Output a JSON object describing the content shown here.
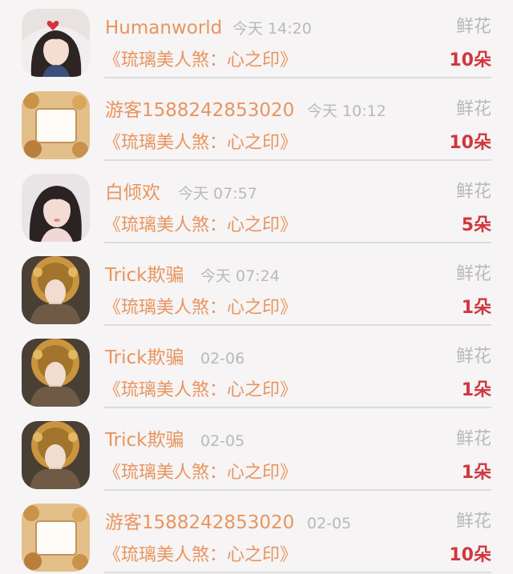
{
  "records": [
    {
      "user": "Humanworld",
      "time": "今天 14:20",
      "gift": "鲜花",
      "title": "《琉璃美人煞：心之印》",
      "count": "10朵",
      "avatar_icon": "girl-heart-avatar"
    },
    {
      "user": "游客1588242853020",
      "time": "今天 10:12",
      "gift": "鲜花",
      "title": "《琉璃美人煞：心之印》",
      "count": "10朵",
      "avatar_icon": "floral-frame-avatar"
    },
    {
      "user": "白倾欢",
      "time": "今天 07:57",
      "gift": "鲜花",
      "title": "《琉璃美人煞：心之印》",
      "count": "5朵",
      "avatar_icon": "woman-portrait-avatar"
    },
    {
      "user": "Trick欺骗",
      "time": "今天 07:24",
      "gift": "鲜花",
      "title": "《琉璃美人煞：心之印》",
      "count": "1朵",
      "avatar_icon": "ornate-headdress-avatar"
    },
    {
      "user": "Trick欺骗",
      "time": "02-06",
      "gift": "鲜花",
      "title": "《琉璃美人煞：心之印》",
      "count": "1朵",
      "avatar_icon": "ornate-headdress-avatar"
    },
    {
      "user": "Trick欺骗",
      "time": "02-05",
      "gift": "鲜花",
      "title": "《琉璃美人煞：心之印》",
      "count": "1朵",
      "avatar_icon": "ornate-headdress-avatar"
    },
    {
      "user": "游客1588242853020",
      "time": "02-05",
      "gift": "鲜花",
      "title": "《琉璃美人煞：心之印》",
      "count": "10朵",
      "avatar_icon": "floral-frame-avatar"
    }
  ],
  "colors": {
    "username": "#e8955e",
    "title": "#e8955e",
    "count": "#d0373e",
    "muted": "#b9b9b9",
    "background": "#f6f4f5"
  }
}
